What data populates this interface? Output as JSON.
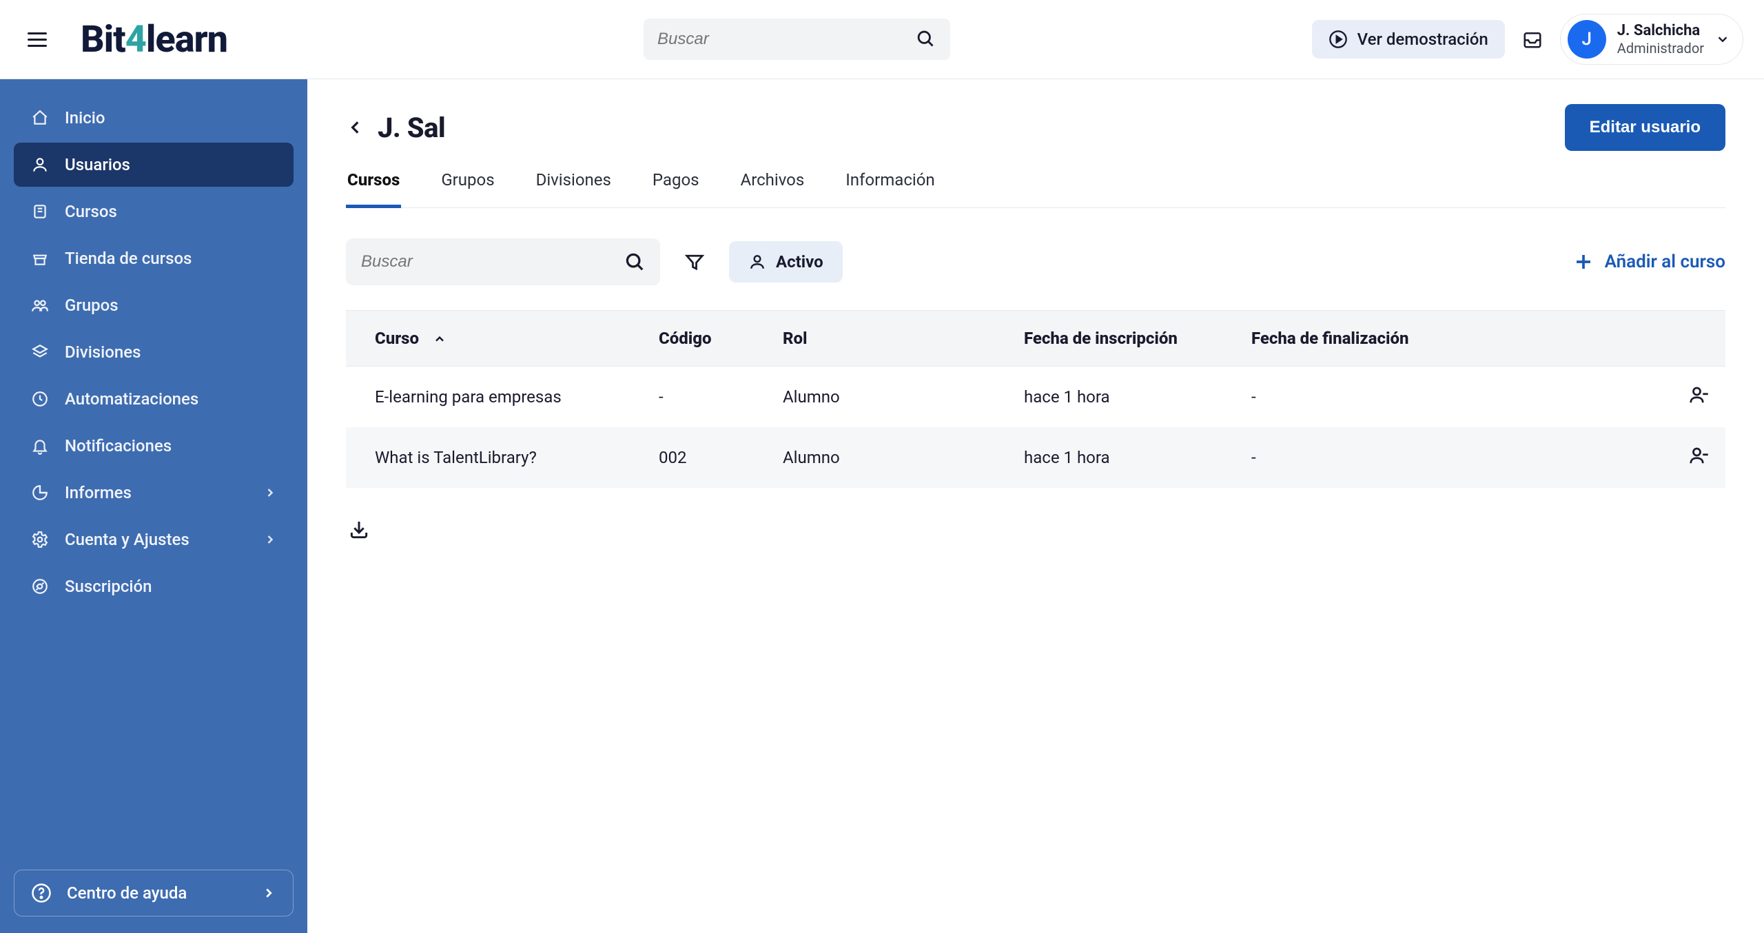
{
  "brand": {
    "part1": "Bit",
    "accent": "4",
    "part2": "learn"
  },
  "header": {
    "search_placeholder": "Buscar",
    "demo_label": "Ver demostración",
    "user": {
      "initial": "J",
      "name": "J. Salchicha",
      "role": "Administrador"
    }
  },
  "sidebar": {
    "items": [
      {
        "icon": "home",
        "label": "Inicio"
      },
      {
        "icon": "user",
        "label": "Usuarios",
        "active": true
      },
      {
        "icon": "book",
        "label": "Cursos"
      },
      {
        "icon": "store",
        "label": "Tienda de cursos"
      },
      {
        "icon": "group",
        "label": "Grupos"
      },
      {
        "icon": "layers",
        "label": "Divisiones"
      },
      {
        "icon": "automation",
        "label": "Automatizaciones"
      },
      {
        "icon": "bell",
        "label": "Notificaciones"
      },
      {
        "icon": "pie",
        "label": "Informes",
        "expandable": true
      },
      {
        "icon": "settings",
        "label": "Cuenta y Ajustes",
        "expandable": true
      },
      {
        "icon": "subscription",
        "label": "Suscripción"
      }
    ],
    "help_label": "Centro de ayuda"
  },
  "page": {
    "title": "J. Sal",
    "edit_button": "Editar usuario",
    "tabs": [
      "Cursos",
      "Grupos",
      "Divisiones",
      "Pagos",
      "Archivos",
      "Información"
    ],
    "active_tab_index": 0,
    "toolbar": {
      "search_placeholder": "Buscar",
      "status_chip": "Activo",
      "add_course": "Añadir al curso"
    },
    "table": {
      "columns": {
        "course": "Curso",
        "code": "Código",
        "role": "Rol",
        "enrolled": "Fecha de inscripción",
        "completed": "Fecha de finalización"
      },
      "rows": [
        {
          "course": "E-learning para empresas",
          "code": "-",
          "role": "Alumno",
          "enrolled": "hace 1 hora",
          "completed": "-"
        },
        {
          "course": "What is TalentLibrary?",
          "code": "002",
          "role": "Alumno",
          "enrolled": "hace 1 hora",
          "completed": "-"
        }
      ]
    }
  }
}
